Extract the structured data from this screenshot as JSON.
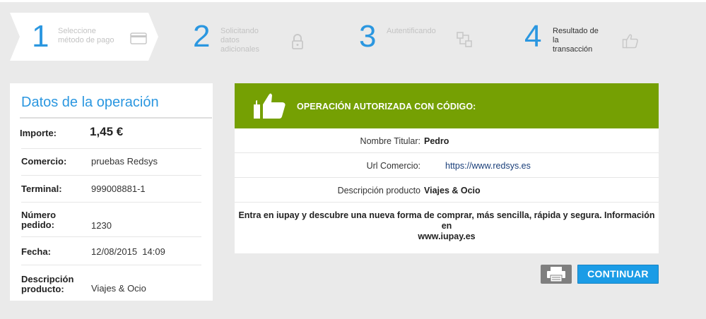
{
  "steps": [
    {
      "number": "1",
      "label_lines": [
        "Seleccione",
        "método de pago"
      ],
      "icon": "credit-card-icon"
    },
    {
      "number": "2",
      "label_lines": [
        "Solicitando",
        "datos",
        "adicionales"
      ],
      "icon": "lock-icon"
    },
    {
      "number": "3",
      "label_lines": [
        "Autentificando"
      ],
      "icon": "connection-icon"
    },
    {
      "number": "4",
      "label_lines": [
        "Resultado de",
        "la",
        "transacción"
      ],
      "icon": "thumbs-up-icon"
    }
  ],
  "operation": {
    "title": "Datos de la operación",
    "amount_label": "Importe:",
    "amount_value": "1,45 €",
    "merchant_label": "Comercio:",
    "merchant_value": "pruebas Redsys",
    "terminal_label": "Terminal:",
    "terminal_value": "999008881-1",
    "order_label_1": "Número",
    "order_label_2": "pedido:",
    "order_value": "1230",
    "date_label": "Fecha:",
    "date_value": "12/08/2015  14:09",
    "desc_label_1": "Descripción",
    "desc_label_2": "producto:",
    "desc_value": "Viajes & Ocio"
  },
  "result": {
    "title": "OPERACIÓN AUTORIZADA CON CÓDIGO:",
    "holder_label": "Nombre Titular:",
    "holder_value": "Pedro",
    "url_label": "Url Comercio:",
    "url_value": "https://www.redsys.es",
    "product_label": "Descripción producto",
    "product_value": "Viajes & Ocio",
    "promo_line1": "Entra en iupay y descubre una nueva forma de comprar, más sencilla, rápida y segura. Información en",
    "promo_line2": "www.iupay.es"
  },
  "buttons": {
    "print_icon": "printer-icon",
    "continue_label": "CONTINUAR"
  },
  "colors": {
    "accent_blue": "#2b97e0",
    "success_green": "#75a003",
    "button_blue": "#1b9ce6"
  }
}
